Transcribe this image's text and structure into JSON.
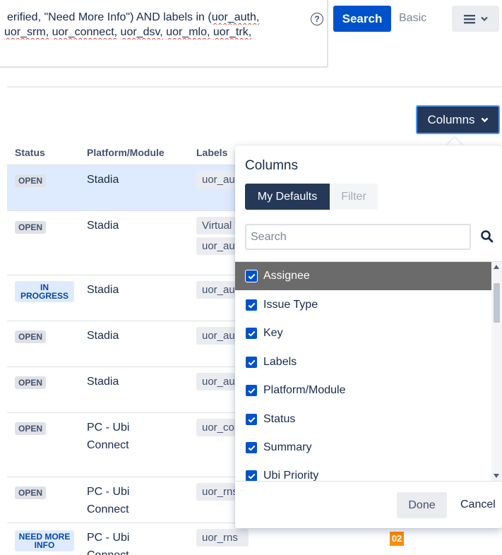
{
  "query": {
    "line1_plain_before": "erified, \"Need More Info\") AND labels in (",
    "line1_squiggle": "uor_auth,",
    "line2_parts": [
      "uor_srm,",
      " ",
      "uor_connect,",
      " ",
      "uor_dsv,",
      " ",
      "uor_mlo,",
      " ",
      "uor_trk,"
    ],
    "help_glyph": "?"
  },
  "toolbar": {
    "search_label": "Search",
    "basic_label": "Basic",
    "menu_icon": "hamburger-icon",
    "columns_label": "Columns"
  },
  "table": {
    "headers": {
      "status": "Status",
      "platform": "Platform/Module",
      "labels": "Labels"
    },
    "rows": [
      {
        "status": "OPEN",
        "platform": "Stadia",
        "labels": [
          "uor_auth"
        ]
      },
      {
        "status": "OPEN",
        "platform": "Stadia",
        "labels": [
          "Virtual",
          "uor_auth"
        ]
      },
      {
        "status": "IN PROGRESS",
        "platform": "Stadia",
        "labels": [
          "uor_auth"
        ]
      },
      {
        "status": "OPEN",
        "platform": "Stadia",
        "labels": [
          "uor_auth"
        ]
      },
      {
        "status": "OPEN",
        "platform": "Stadia",
        "labels": [
          "uor_auth"
        ]
      },
      {
        "status": "OPEN",
        "platform": "PC - Ubi Connect",
        "labels": [
          "uor_connect"
        ]
      },
      {
        "status": "OPEN",
        "platform": "PC - Ubi Connect",
        "labels": [
          "uor_rns"
        ]
      },
      {
        "status": "NEED MORE INFO",
        "platform": "PC - Ubi Connect",
        "labels": [
          "uor_rns"
        ],
        "priority": "02"
      }
    ]
  },
  "columns_panel": {
    "title": "Columns",
    "tab_defaults": "My Defaults",
    "tab_filter": "Filter",
    "search_placeholder": "Search",
    "items": [
      {
        "label": "Assignee",
        "checked": true
      },
      {
        "label": "Issue Type",
        "checked": true
      },
      {
        "label": "Key",
        "checked": true
      },
      {
        "label": "Labels",
        "checked": true
      },
      {
        "label": "Platform/Module",
        "checked": true
      },
      {
        "label": "Status",
        "checked": true
      },
      {
        "label": "Summary",
        "checked": true
      },
      {
        "label": "Ubi Priority",
        "checked": true
      }
    ],
    "done_label": "Done",
    "cancel_label": "Cancel"
  },
  "colors": {
    "primary": "#0052cc",
    "dark_navy": "#253858",
    "selected_row": "#deebff",
    "priority_orange": "#ff8b00"
  }
}
